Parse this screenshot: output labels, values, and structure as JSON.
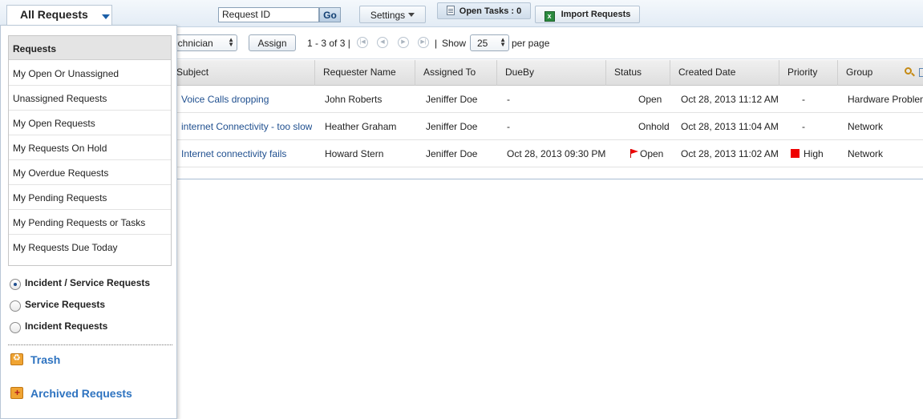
{
  "toolbar": {
    "view_selector": "All Requests",
    "search_placeholder": "Request ID",
    "go_label": "Go",
    "settings_label": "Settings",
    "open_tasks_label": "Open Tasks : 0",
    "import_label": "Import Requests"
  },
  "controls": {
    "technician_select": "Technician",
    "assign_label": "Assign",
    "pager_text": "1 - 3 of 3 |",
    "separator": "|",
    "show_label": "Show",
    "page_size": "25",
    "per_page_label": "per page"
  },
  "table": {
    "columns": [
      "Subject",
      "Requester Name",
      "Assigned To",
      "DueBy",
      "Status",
      "Created Date",
      "Priority",
      "Group"
    ],
    "rows": [
      {
        "subject": "Voice Calls dropping",
        "requester": "John Roberts",
        "assigned": "Jeniffer Doe",
        "dueby": "-",
        "status": "Open",
        "created": "Oct 28, 2013 11:12 AM",
        "priority": "-",
        "group": "Hardware Problems"
      },
      {
        "subject": "internet Connectivity - too slow",
        "requester": "Heather Graham",
        "assigned": "Jeniffer Doe",
        "dueby": "-",
        "status": "Onhold",
        "created": "Oct 28, 2013 11:04 AM",
        "priority": "-",
        "group": "Network"
      },
      {
        "subject": "Internet connectivity fails",
        "requester": "Howard Stern",
        "assigned": "Jeniffer Doe",
        "dueby": "Oct 28, 2013 09:30 PM",
        "status": "Open",
        "created": "Oct 28, 2013 11:02 AM",
        "priority": "High",
        "group": "Network"
      }
    ]
  },
  "dropdown": {
    "header": "Requests",
    "items": [
      "My Open Or Unassigned",
      "Unassigned Requests",
      "My Open Requests",
      "My Requests On Hold",
      "My Overdue Requests",
      "My Pending Requests",
      "My Pending Requests or Tasks",
      "My Requests Due Today"
    ],
    "radio_options": [
      {
        "label": "Incident / Service Requests",
        "selected": true
      },
      {
        "label": "Service Requests",
        "selected": false
      },
      {
        "label": "Incident Requests",
        "selected": false
      }
    ],
    "trash_label": "Trash",
    "archived_label": "Archived Requests"
  },
  "colors": {
    "link": "#1f4f8f",
    "side_link": "#2e73c0",
    "priority_high": "#e00000"
  }
}
